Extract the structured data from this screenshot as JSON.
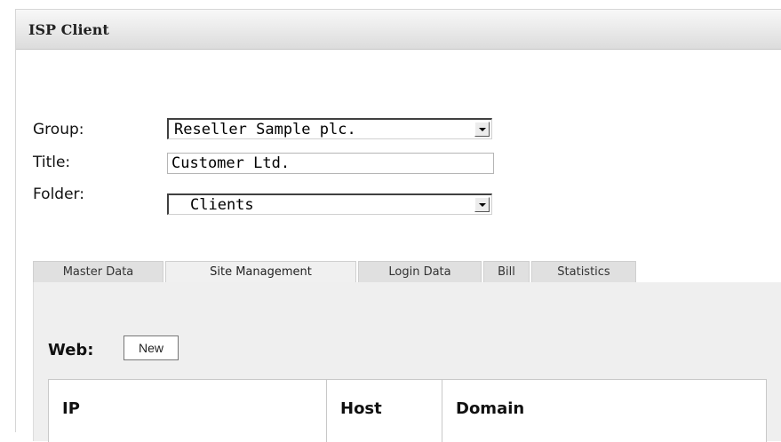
{
  "window": {
    "title": "ISP Client"
  },
  "form": {
    "group_label": "Group:",
    "group_value": "Reseller Sample plc.",
    "title_label": "Title:",
    "title_value": "Customer Ltd.",
    "folder_label": "Folder:",
    "folder_value": "Clients"
  },
  "tabs": [
    {
      "label": "Master Data",
      "active": false
    },
    {
      "label": "Site Management",
      "active": true
    },
    {
      "label": "Login Data",
      "active": false
    },
    {
      "label": "Bill",
      "active": false
    },
    {
      "label": "Statistics",
      "active": false
    }
  ],
  "web": {
    "label": "Web:",
    "new_button": "New",
    "columns": [
      "IP",
      "Host",
      "Domain"
    ]
  }
}
